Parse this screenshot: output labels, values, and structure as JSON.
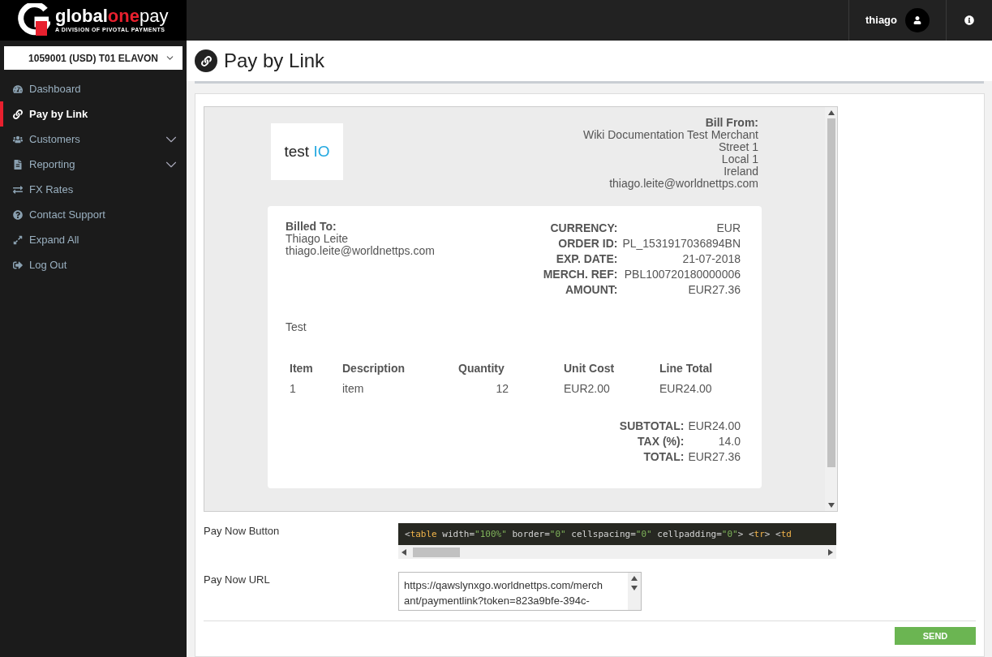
{
  "brand": {
    "name_parts": [
      {
        "text": "global",
        "kind": "plain"
      },
      {
        "text": "one",
        "kind": "accent"
      },
      {
        "text": "pay",
        "kind": "light"
      }
    ],
    "tagline": "A DIVISION OF PIVOTAL PAYMENTS"
  },
  "account_select": {
    "value": "1059001 (USD) T01 ELAVON"
  },
  "sidebar": {
    "items": [
      {
        "label": "Dashboard",
        "selected": false,
        "expandable": false
      },
      {
        "label": "Pay by Link",
        "selected": true,
        "expandable": false
      },
      {
        "label": "Customers",
        "selected": false,
        "expandable": true
      },
      {
        "label": "Reporting",
        "selected": false,
        "expandable": true
      },
      {
        "label": "FX Rates",
        "selected": false,
        "expandable": false
      },
      {
        "label": "Contact Support",
        "selected": false,
        "expandable": false
      },
      {
        "label": "Expand All",
        "selected": false,
        "expandable": false
      },
      {
        "label": "Log Out",
        "selected": false,
        "expandable": false
      }
    ]
  },
  "topbar": {
    "username": "thiago"
  },
  "page": {
    "title": "Pay by Link"
  },
  "invoice": {
    "logo": {
      "text": "test",
      "accent": "IO"
    },
    "bill_from": {
      "heading": "Bill From:",
      "lines": [
        "Wiki Documentation Test Merchant",
        "Street 1",
        "Local 1",
        "Ireland",
        "thiago.leite@worldnettps.com"
      ]
    },
    "billed_to": {
      "heading": "Billed To:",
      "lines": [
        "Thiago Leite",
        "thiago.leite@worldnettps.com"
      ]
    },
    "details": [
      {
        "label": "CURRENCY:",
        "value": "EUR"
      },
      {
        "label": "ORDER ID:",
        "value": "PL_1531917036894BN"
      },
      {
        "label": "EXP. DATE:",
        "value": "21-07-2018"
      },
      {
        "label": "MERCH. REF:",
        "value": "PBL100720180000006"
      },
      {
        "label": "AMOUNT:",
        "value": "EUR27.36"
      }
    ],
    "note": "Test",
    "table": {
      "columns": [
        "Item",
        "Description",
        "Quantity",
        "Unit Cost",
        "Line Total"
      ],
      "rows": [
        [
          "1",
          "item",
          "12",
          "EUR2.00",
          "EUR24.00"
        ]
      ]
    },
    "totals": [
      {
        "label": "SUBTOTAL:",
        "value": "EUR24.00"
      },
      {
        "label": "TAX (%):",
        "value": "14.0"
      },
      {
        "label": "TOTAL:",
        "value": "EUR27.36"
      }
    ]
  },
  "pay_now_button": {
    "label": "Pay Now Button",
    "code": [
      {
        "kind": "punct",
        "text": "<"
      },
      {
        "kind": "tag",
        "text": "table"
      },
      {
        "kind": "attr",
        "text": " width="
      },
      {
        "kind": "value",
        "text": "\"100%\""
      },
      {
        "kind": "attr",
        "text": " border="
      },
      {
        "kind": "value",
        "text": "\"0\""
      },
      {
        "kind": "attr",
        "text": " cellspacing="
      },
      {
        "kind": "value",
        "text": "\"0\""
      },
      {
        "kind": "attr",
        "text": " cellpadding="
      },
      {
        "kind": "value",
        "text": "\"0\""
      },
      {
        "kind": "punct",
        "text": "> <"
      },
      {
        "kind": "tag",
        "text": "tr"
      },
      {
        "kind": "punct",
        "text": "> <"
      },
      {
        "kind": "tag",
        "text": "td"
      }
    ]
  },
  "pay_now_url": {
    "label": "Pay Now URL",
    "lines": [
      "https://qawslynxgo.worldnettps.com/merch",
      "ant/paymentlink?token=823a9bfe-394c-"
    ]
  },
  "send_button": {
    "label": "SEND"
  }
}
